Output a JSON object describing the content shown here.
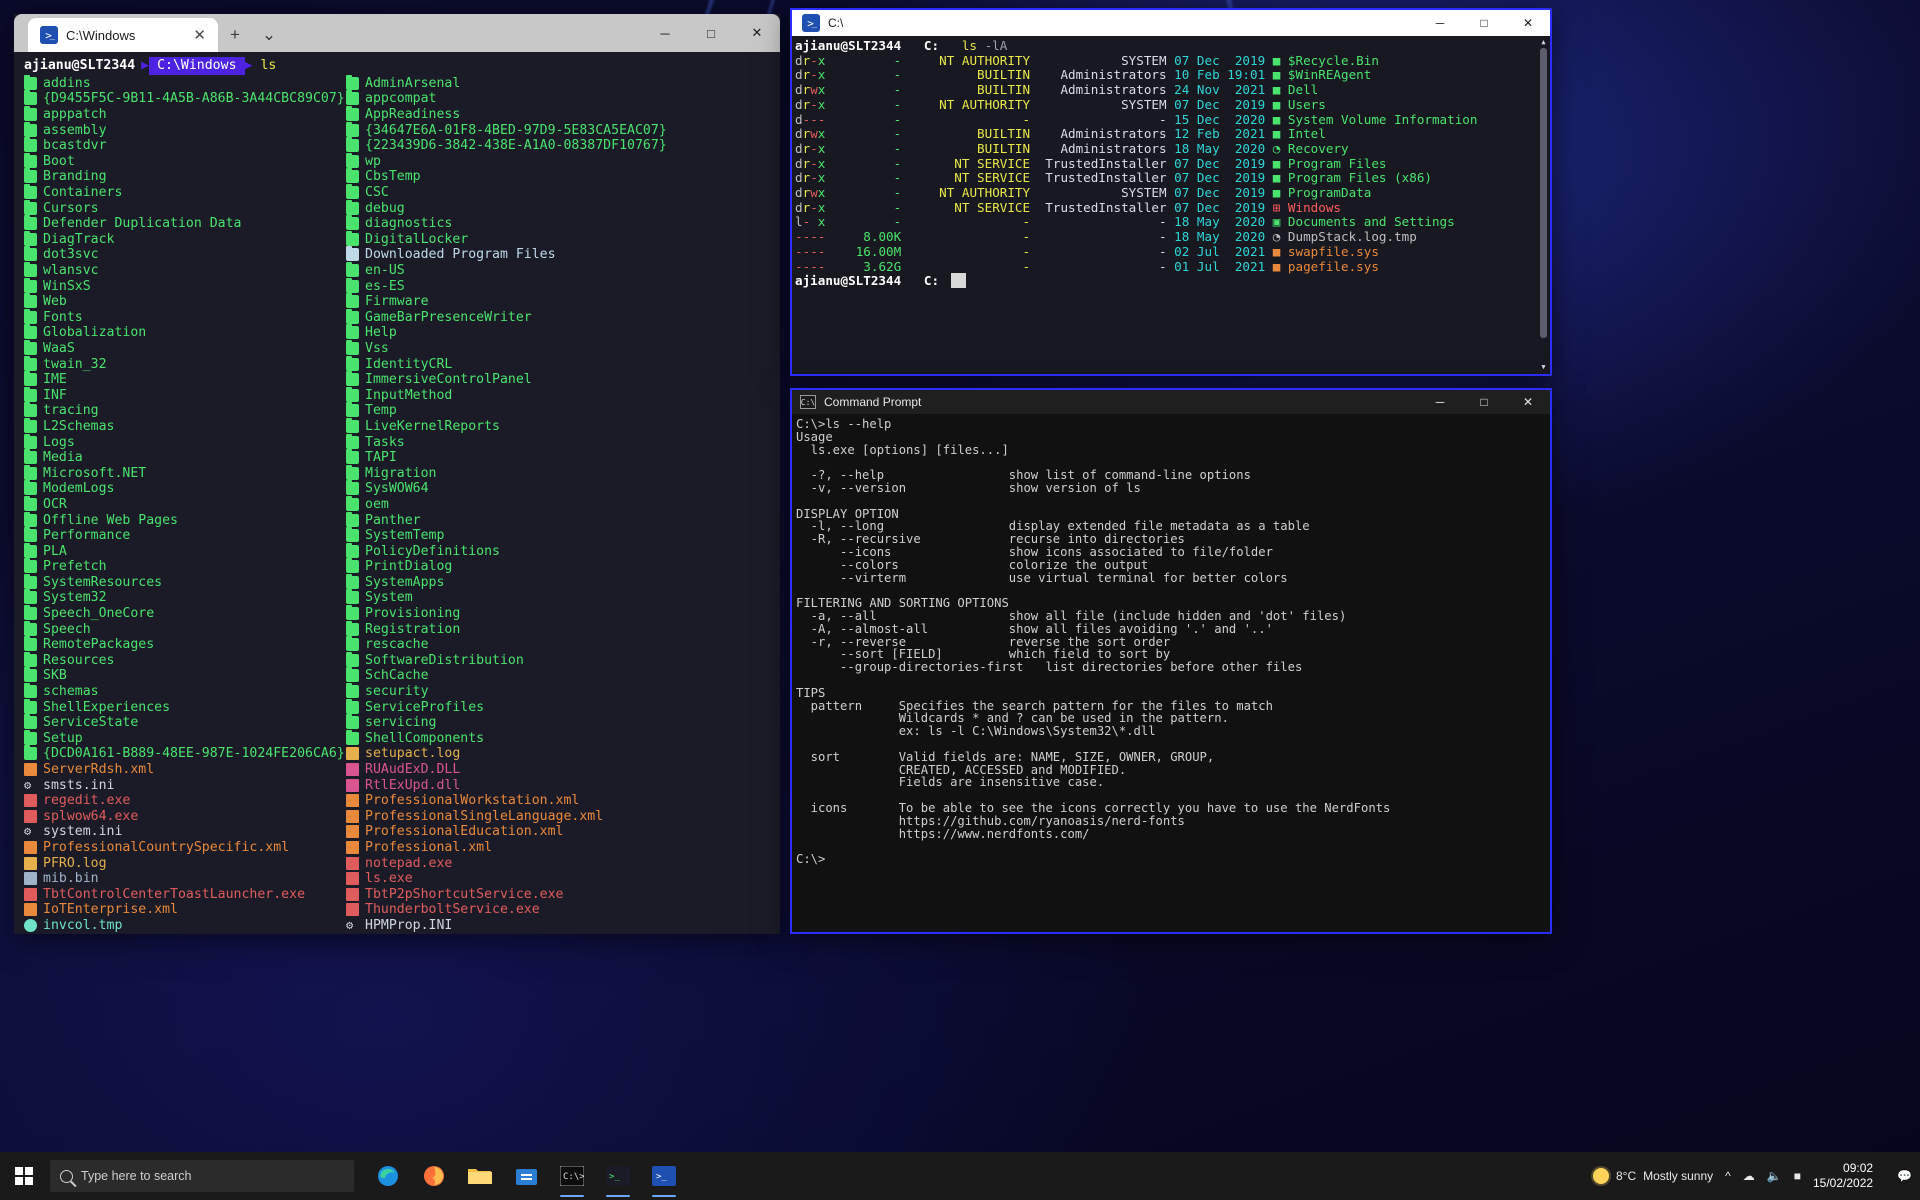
{
  "terminal_left": {
    "tab_title": "C:\\Windows",
    "tab_icon": "powershell-icon",
    "new_tab_label": "+",
    "tab_menu_label": "⌄",
    "minimize": "─",
    "maximize": "□",
    "close": "✕",
    "prompt": {
      "user": "ajianu@SLT2344",
      "path": "C:\\Windows",
      "command": "ls"
    },
    "column1": [
      {
        "name": "addins",
        "type": "folder"
      },
      {
        "name": "{D9455F5C-9B11-4A5B-A86B-3A44CBC89C07}",
        "type": "folder"
      },
      {
        "name": "apppatch",
        "type": "folder"
      },
      {
        "name": "assembly",
        "type": "folder"
      },
      {
        "name": "bcastdvr",
        "type": "folder"
      },
      {
        "name": "Boot",
        "type": "folder"
      },
      {
        "name": "Branding",
        "type": "folder"
      },
      {
        "name": "Containers",
        "type": "folder"
      },
      {
        "name": "Cursors",
        "type": "folder"
      },
      {
        "name": "Defender Duplication Data",
        "type": "folder"
      },
      {
        "name": "DiagTrack",
        "type": "folder"
      },
      {
        "name": "dot3svc",
        "type": "folder"
      },
      {
        "name": "wlansvc",
        "type": "folder"
      },
      {
        "name": "WinSxS",
        "type": "folder"
      },
      {
        "name": "Web",
        "type": "folder"
      },
      {
        "name": "Fonts",
        "type": "folder"
      },
      {
        "name": "Globalization",
        "type": "folder"
      },
      {
        "name": "WaaS",
        "type": "folder"
      },
      {
        "name": "twain_32",
        "type": "folder"
      },
      {
        "name": "IME",
        "type": "folder"
      },
      {
        "name": "INF",
        "type": "folder"
      },
      {
        "name": "tracing",
        "type": "folder"
      },
      {
        "name": "L2Schemas",
        "type": "folder"
      },
      {
        "name": "Logs",
        "type": "folder"
      },
      {
        "name": "Media",
        "type": "folder"
      },
      {
        "name": "Microsoft.NET",
        "type": "folder"
      },
      {
        "name": "ModemLogs",
        "type": "folder"
      },
      {
        "name": "OCR",
        "type": "folder"
      },
      {
        "name": "Offline Web Pages",
        "type": "folder"
      },
      {
        "name": "Performance",
        "type": "folder"
      },
      {
        "name": "PLA",
        "type": "folder"
      },
      {
        "name": "Prefetch",
        "type": "folder"
      },
      {
        "name": "SystemResources",
        "type": "folder"
      },
      {
        "name": "System32",
        "type": "folder"
      },
      {
        "name": "Speech_OneCore",
        "type": "folder"
      },
      {
        "name": "Speech",
        "type": "folder"
      },
      {
        "name": "RemotePackages",
        "type": "folder"
      },
      {
        "name": "Resources",
        "type": "folder"
      },
      {
        "name": "SKB",
        "type": "folder"
      },
      {
        "name": "schemas",
        "type": "folder"
      },
      {
        "name": "ShellExperiences",
        "type": "folder"
      },
      {
        "name": "ServiceState",
        "type": "folder"
      },
      {
        "name": "Setup",
        "type": "folder"
      },
      {
        "name": "{DCD0A161-B889-48EE-987E-1024FE206CA6}",
        "type": "folder"
      },
      {
        "name": "ServerRdsh.xml",
        "type": "xml"
      },
      {
        "name": "smsts.ini",
        "type": "gear"
      },
      {
        "name": "regedit.exe",
        "type": "exe"
      },
      {
        "name": "splwow64.exe",
        "type": "exe"
      },
      {
        "name": "system.ini",
        "type": "gear"
      },
      {
        "name": "ProfessionalCountrySpecific.xml",
        "type": "xml"
      },
      {
        "name": "PFRO.log",
        "type": "log"
      },
      {
        "name": "mib.bin",
        "type": "bin"
      },
      {
        "name": "TbtControlCenterToastLauncher.exe",
        "type": "exe"
      },
      {
        "name": "IoTEnterprise.xml",
        "type": "xml"
      },
      {
        "name": "invcol.tmp",
        "type": "tmp"
      }
    ],
    "column2": [
      {
        "name": "AdminArsenal",
        "type": "folder"
      },
      {
        "name": "appcompat",
        "type": "folder"
      },
      {
        "name": "AppReadiness",
        "type": "folder"
      },
      {
        "name": "{34647E6A-01F8-4BED-97D9-5E83CA5EAC07}",
        "type": "folder"
      },
      {
        "name": "{223439D6-3842-438E-A1A0-08387DF10767}",
        "type": "folder"
      },
      {
        "name": "wp",
        "type": "folder"
      },
      {
        "name": "CbsTemp",
        "type": "folder"
      },
      {
        "name": "CSC",
        "type": "folder"
      },
      {
        "name": "debug",
        "type": "folder"
      },
      {
        "name": "diagnostics",
        "type": "folder"
      },
      {
        "name": "DigitalLocker",
        "type": "folder"
      },
      {
        "name": "Downloaded Program Files",
        "type": "folder-special"
      },
      {
        "name": "en-US",
        "type": "folder"
      },
      {
        "name": "es-ES",
        "type": "folder"
      },
      {
        "name": "Firmware",
        "type": "folder"
      },
      {
        "name": "GameBarPresenceWriter",
        "type": "folder"
      },
      {
        "name": "Help",
        "type": "folder"
      },
      {
        "name": "Vss",
        "type": "folder"
      },
      {
        "name": "IdentityCRL",
        "type": "folder"
      },
      {
        "name": "ImmersiveControlPanel",
        "type": "folder"
      },
      {
        "name": "InputMethod",
        "type": "folder"
      },
      {
        "name": "Temp",
        "type": "folder"
      },
      {
        "name": "LiveKernelReports",
        "type": "folder"
      },
      {
        "name": "Tasks",
        "type": "folder"
      },
      {
        "name": "TAPI",
        "type": "folder"
      },
      {
        "name": "Migration",
        "type": "folder"
      },
      {
        "name": "SysWOW64",
        "type": "folder"
      },
      {
        "name": "oem",
        "type": "folder"
      },
      {
        "name": "Panther",
        "type": "folder"
      },
      {
        "name": "SystemTemp",
        "type": "folder"
      },
      {
        "name": "PolicyDefinitions",
        "type": "folder"
      },
      {
        "name": "PrintDialog",
        "type": "folder"
      },
      {
        "name": "SystemApps",
        "type": "folder"
      },
      {
        "name": "System",
        "type": "folder"
      },
      {
        "name": "Provisioning",
        "type": "folder"
      },
      {
        "name": "Registration",
        "type": "folder"
      },
      {
        "name": "rescache",
        "type": "folder"
      },
      {
        "name": "SoftwareDistribution",
        "type": "folder"
      },
      {
        "name": "SchCache",
        "type": "folder"
      },
      {
        "name": "security",
        "type": "folder"
      },
      {
        "name": "ServiceProfiles",
        "type": "folder"
      },
      {
        "name": "servicing",
        "type": "folder"
      },
      {
        "name": "ShellComponents",
        "type": "folder"
      },
      {
        "name": "setupact.log",
        "type": "log"
      },
      {
        "name": "RUAudExD.DLL",
        "type": "dll"
      },
      {
        "name": "RtlExUpd.dll",
        "type": "dll"
      },
      {
        "name": "ProfessionalWorkstation.xml",
        "type": "xml"
      },
      {
        "name": "ProfessionalSingleLanguage.xml",
        "type": "xml"
      },
      {
        "name": "ProfessionalEducation.xml",
        "type": "xml"
      },
      {
        "name": "Professional.xml",
        "type": "xml"
      },
      {
        "name": "notepad.exe",
        "type": "exe"
      },
      {
        "name": "ls.exe",
        "type": "exe"
      },
      {
        "name": "TbtP2pShortcutService.exe",
        "type": "exe"
      },
      {
        "name": "ThunderboltService.exe",
        "type": "exe"
      },
      {
        "name": "HPMProp.INI",
        "type": "gear"
      }
    ]
  },
  "terminal_right": {
    "tab_title": "C:\\",
    "tab_icon": "powershell-icon",
    "minimize": "─",
    "maximize": "□",
    "close": "✕",
    "prompt": {
      "user": "ajianu@SLT2344",
      "path": "C:",
      "command": "ls",
      "args": "-lA"
    },
    "prompt_tail": {
      "user": "ajianu@SLT2344",
      "path": "C:"
    },
    "rows": [
      {
        "perm": "dr-x",
        "size": "-",
        "owner": "NT AUTHORITY",
        "group": "SYSTEM",
        "date": "07 Dec  2019",
        "name": "$Recycle.Bin",
        "name_color": "green",
        "icon": "folder-icon"
      },
      {
        "perm": "dr-x",
        "size": "-",
        "owner": "BUILTIN",
        "group": "Administrators",
        "date": "10 Feb 19:01",
        "name": "$WinREAgent",
        "name_color": "green",
        "icon": "folder-icon"
      },
      {
        "perm": "drwx",
        "size": "-",
        "owner": "BUILTIN",
        "group": "Administrators",
        "date": "24 Nov  2021",
        "name": "Dell",
        "name_color": "green",
        "icon": "folder-icon"
      },
      {
        "perm": "dr-x",
        "size": "-",
        "owner": "NT AUTHORITY",
        "group": "SYSTEM",
        "date": "07 Dec  2019",
        "name": "Users",
        "name_color": "green",
        "icon": "folder-icon"
      },
      {
        "perm": "d---",
        "size": "-",
        "owner": "-",
        "group": "-",
        "date": "15 Dec  2020",
        "name": "System Volume Information",
        "name_color": "green",
        "icon": "folder-icon"
      },
      {
        "perm": "drwx",
        "size": "-",
        "owner": "BUILTIN",
        "group": "Administrators",
        "date": "12 Feb  2021",
        "name": "Intel",
        "name_color": "green",
        "icon": "folder-icon"
      },
      {
        "perm": "dr-x",
        "size": "-",
        "owner": "BUILTIN",
        "group": "Administrators",
        "date": "18 May  2020",
        "name": "Recovery",
        "name_color": "green",
        "icon": "clock-icon"
      },
      {
        "perm": "dr-x",
        "size": "-",
        "owner": "NT SERVICE",
        "group": "TrustedInstaller",
        "date": "07 Dec  2019",
        "name": "Program Files",
        "name_color": "green",
        "icon": "folder-icon"
      },
      {
        "perm": "dr-x",
        "size": "-",
        "owner": "NT SERVICE",
        "group": "TrustedInstaller",
        "date": "07 Dec  2019",
        "name": "Program Files (x86)",
        "name_color": "green",
        "icon": "folder-icon"
      },
      {
        "perm": "drwx",
        "size": "-",
        "owner": "NT AUTHORITY",
        "group": "SYSTEM",
        "date": "07 Dec  2019",
        "name": "ProgramData",
        "name_color": "green",
        "icon": "folder-icon"
      },
      {
        "perm": "dr-x",
        "size": "-",
        "owner": "NT SERVICE",
        "group": "TrustedInstaller",
        "date": "07 Dec  2019",
        "name": "Windows",
        "name_color": "red",
        "icon": "windows-icon"
      },
      {
        "perm": "l- x",
        "size": "-",
        "owner": "-",
        "group": "-",
        "date": "18 May  2020",
        "name": "Documents and Settings",
        "name_color": "green",
        "icon": "link-icon"
      },
      {
        "perm": "----",
        "size": "8.00K",
        "owner": "-",
        "group": "-",
        "date": "18 May  2020",
        "name": "DumpStack.log.tmp",
        "name_color": "gray",
        "icon": "clock-icon"
      },
      {
        "perm": "----",
        "size": "16.00M",
        "owner": "-",
        "group": "-",
        "date": "02 Jul  2021",
        "name": "swapfile.sys",
        "name_color": "orange",
        "icon": "file-icon"
      },
      {
        "perm": "----",
        "size": "3.62G",
        "owner": "-",
        "group": "-",
        "date": "01 Jul  2021",
        "name": "pagefile.sys",
        "name_color": "orange",
        "icon": "file-icon"
      }
    ]
  },
  "command_prompt": {
    "title": "Command Prompt",
    "icon": "cmd-icon",
    "minimize": "─",
    "maximize": "□",
    "close": "✕",
    "lines": [
      "C:\\>ls --help",
      "Usage",
      "  ls.exe [options] [files...]",
      "",
      "  -?, --help                 show list of command-line options",
      "  -v, --version              show version of ls",
      "",
      "DISPLAY OPTION",
      "  -l, --long                 display extended file metadata as a table",
      "  -R, --recursive            recurse into directories",
      "      --icons                show icons associated to file/folder",
      "      --colors               colorize the output",
      "      --virterm              use virtual terminal for better colors",
      "",
      "FILTERING AND SORTING OPTIONS",
      "  -a, --all                  show all file (include hidden and 'dot' files)",
      "  -A, --almost-all           show all files avoiding '.' and '..'",
      "  -r, --reverse              reverse the sort order",
      "      --sort [FIELD]         which field to sort by",
      "      --group-directories-first   list directories before other files",
      "",
      "TIPS",
      "  pattern     Specifies the search pattern for the files to match",
      "              Wildcards * and ? can be used in the pattern.",
      "              ex: ls -l C:\\Windows\\System32\\*.dll",
      "",
      "  sort        Valid fields are: NAME, SIZE, OWNER, GROUP,",
      "              CREATED, ACCESSED and MODIFIED.",
      "              Fields are insensitive case.",
      "",
      "  icons       To be able to see the icons correctly you have to use the NerdFonts",
      "              https://github.com/ryanoasis/nerd-fonts",
      "              https://www.nerdfonts.com/",
      "",
      "C:\\>"
    ]
  },
  "taskbar": {
    "start_label": "Start",
    "search_placeholder": "Type here to search",
    "apps": [
      {
        "name": "edge",
        "label": "Microsoft Edge",
        "active": false
      },
      {
        "name": "firefox",
        "label": "Firefox",
        "active": false
      },
      {
        "name": "file-explorer",
        "label": "File Explorer",
        "active": false
      },
      {
        "name": "store",
        "label": "Microsoft Store",
        "active": false
      },
      {
        "name": "command-prompt",
        "label": "Command Prompt",
        "active": true
      },
      {
        "name": "terminal",
        "label": "Terminal",
        "active": true
      },
      {
        "name": "windows-terminal",
        "label": "Windows Terminal",
        "active": true
      }
    ],
    "weather": {
      "temp": "8°C",
      "condition": "Mostly sunny"
    },
    "tray": [
      "⌃",
      "🔋",
      "🔊"
    ],
    "clock": {
      "time": "09:02",
      "date": "15/02/2022"
    }
  }
}
